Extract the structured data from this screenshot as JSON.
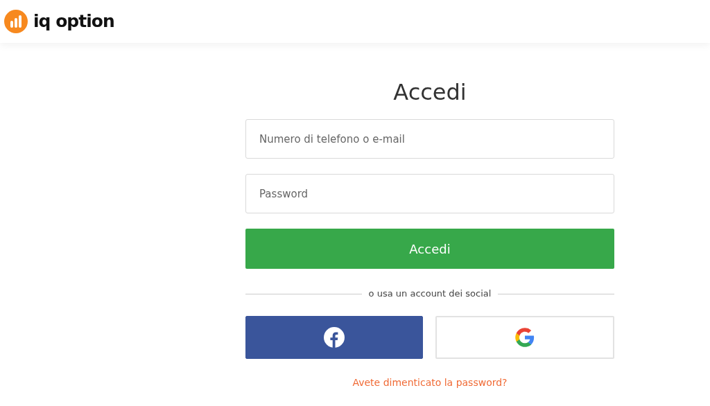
{
  "header": {
    "brand": "iq option"
  },
  "form": {
    "title": "Accedi",
    "fields": [
      {
        "placeholder": "Numero di telefono o e-mail"
      },
      {
        "placeholder": "Password"
      }
    ],
    "submit": "Accedi",
    "divider": "o usa un account dei social",
    "social_buttons": [
      {
        "kind": "facebook"
      },
      {
        "kind": "google"
      }
    ],
    "forgot_link": "Avete dimenticato la password?"
  }
}
